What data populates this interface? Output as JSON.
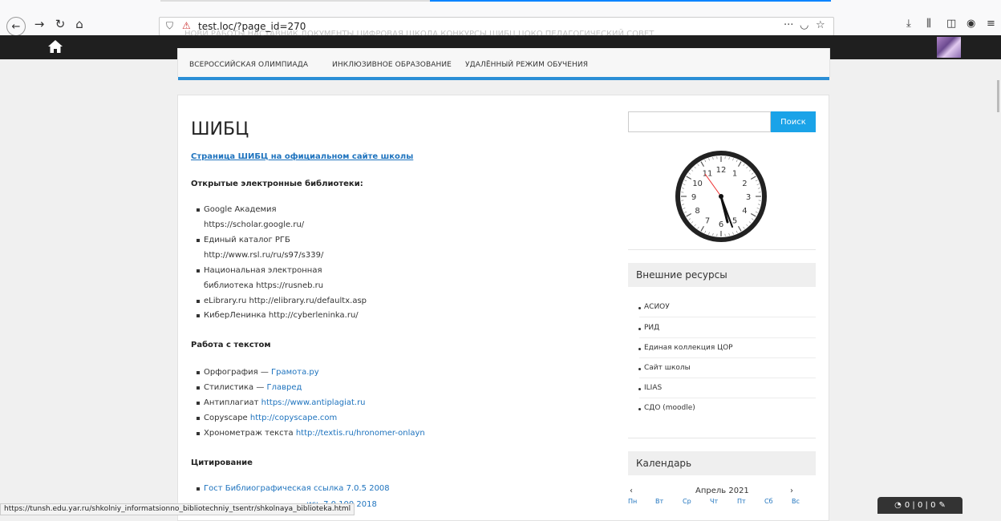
{
  "browser": {
    "url": "test.loc/?page_id=270"
  },
  "nav": {
    "faded_items": "НОВИ РАБОТЫ   НАСТАВНИК   ДОКУМЕНТЫ   ЦИФРОВАЯ ШКОЛА   КОНКУРСЫ   ШИБЦ   ЦОКО   ПЕДАГОГИЧЕСКИЙ СОВЕТ",
    "items": [
      "ВСЕРОССИЙСКАЯ ОЛИМПИАДА",
      "ИНКЛЮЗИВНОЕ ОБРАЗОВАНИЕ",
      "УДАЛЁННЫЙ РЕЖИМ ОБУЧЕНИЯ"
    ]
  },
  "page": {
    "title": "ШИБЦ",
    "main_link": "Страница ШИБЦ на официальном сайте школы",
    "libs_heading": "Открытые электронные библиотеки:",
    "libs": [
      "Google Академия",
      "https://scholar.google.ru/",
      "Единый каталог РГБ",
      "http://www.rsl.ru/ru/s97/s339/",
      "Национальная электронная",
      "библиотека https://rusneb.ru",
      "eLibrary.ru http://elibrary.ru/defaultx.asp",
      "КиберЛенинка http://cyberleninka.ru/"
    ],
    "text_heading": "Работа с текстом",
    "text_tools": [
      {
        "label": "Орфография — ",
        "link": "Грамота.ру"
      },
      {
        "label": "Стилистика — ",
        "link": "Главред"
      },
      {
        "label": "Антиплагиат ",
        "link": "https://www.antiplagiat.ru"
      },
      {
        "label": "Copyscape ",
        "link": "http://copyscape.com"
      },
      {
        "label": "Хронометраж текста ",
        "link": "http://textis.ru/hronomer-onlayn"
      }
    ],
    "cite_heading": "Цитирование",
    "cite_items": [
      "Гост Библиографическая ссылка 7.0.5 2008",
      "ись 7.0.100 2018"
    ]
  },
  "sidebar": {
    "search_button": "Поиск",
    "clock_numbers": [
      "12",
      "1",
      "2",
      "3",
      "4",
      "5",
      "6",
      "7",
      "8",
      "9",
      "10",
      "11"
    ],
    "resources_title": "Внешние ресурсы",
    "resources": [
      "АСИОУ",
      "РИД",
      "Единая коллекция ЦОР",
      "Сайт школы",
      "ILIAS",
      "СДО (moodle)"
    ],
    "calendar_title": "Календарь",
    "calendar_month": "Апрель 2021",
    "calendar_prev": "‹",
    "calendar_next": "›",
    "weekdays": [
      "Пн",
      "Вт",
      "Ср",
      "Чт",
      "Пт",
      "Сб",
      "Вс"
    ]
  },
  "status": {
    "hover_url": "https://tunsh.edu.yar.ru/shkolniy_informatsionno_bibliotechniy_tsentr/shkolnaya_biblioteka.html",
    "counters": "0 | 0 | 0"
  }
}
